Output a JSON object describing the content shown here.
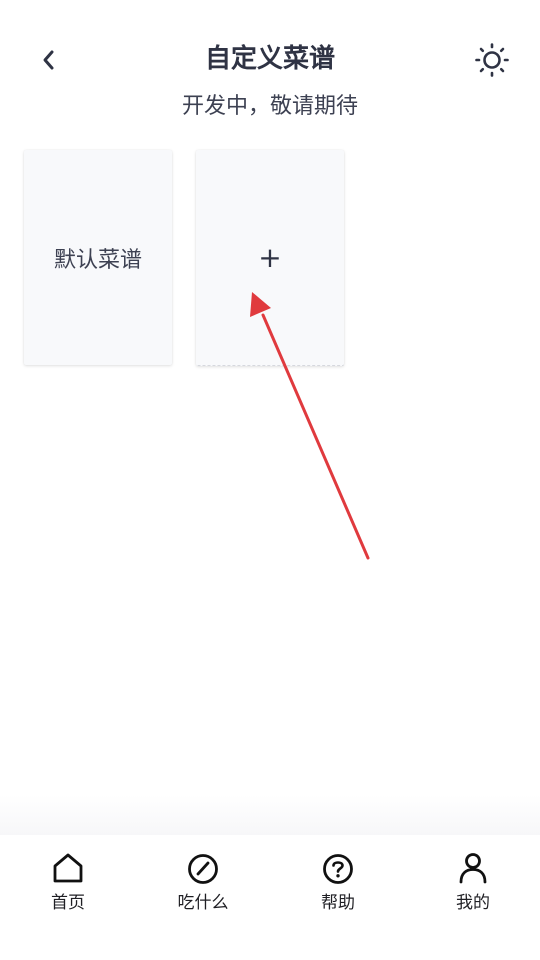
{
  "header": {
    "title": "自定义菜谱",
    "subtitle": "开发中，敬请期待",
    "back_icon": "chevron-left-icon",
    "theme_icon": "sun-icon"
  },
  "cards": [
    {
      "label": "默认菜谱"
    },
    {
      "label": "+"
    }
  ],
  "annotation": {
    "arrow_color": "#e03a3e"
  },
  "tabbar": {
    "items": [
      {
        "label": "首页",
        "icon": "home-icon"
      },
      {
        "label": "吃什么",
        "icon": "gauge-icon"
      },
      {
        "label": "帮助",
        "icon": "question-circle-icon"
      },
      {
        "label": "我的",
        "icon": "user-icon"
      }
    ]
  }
}
